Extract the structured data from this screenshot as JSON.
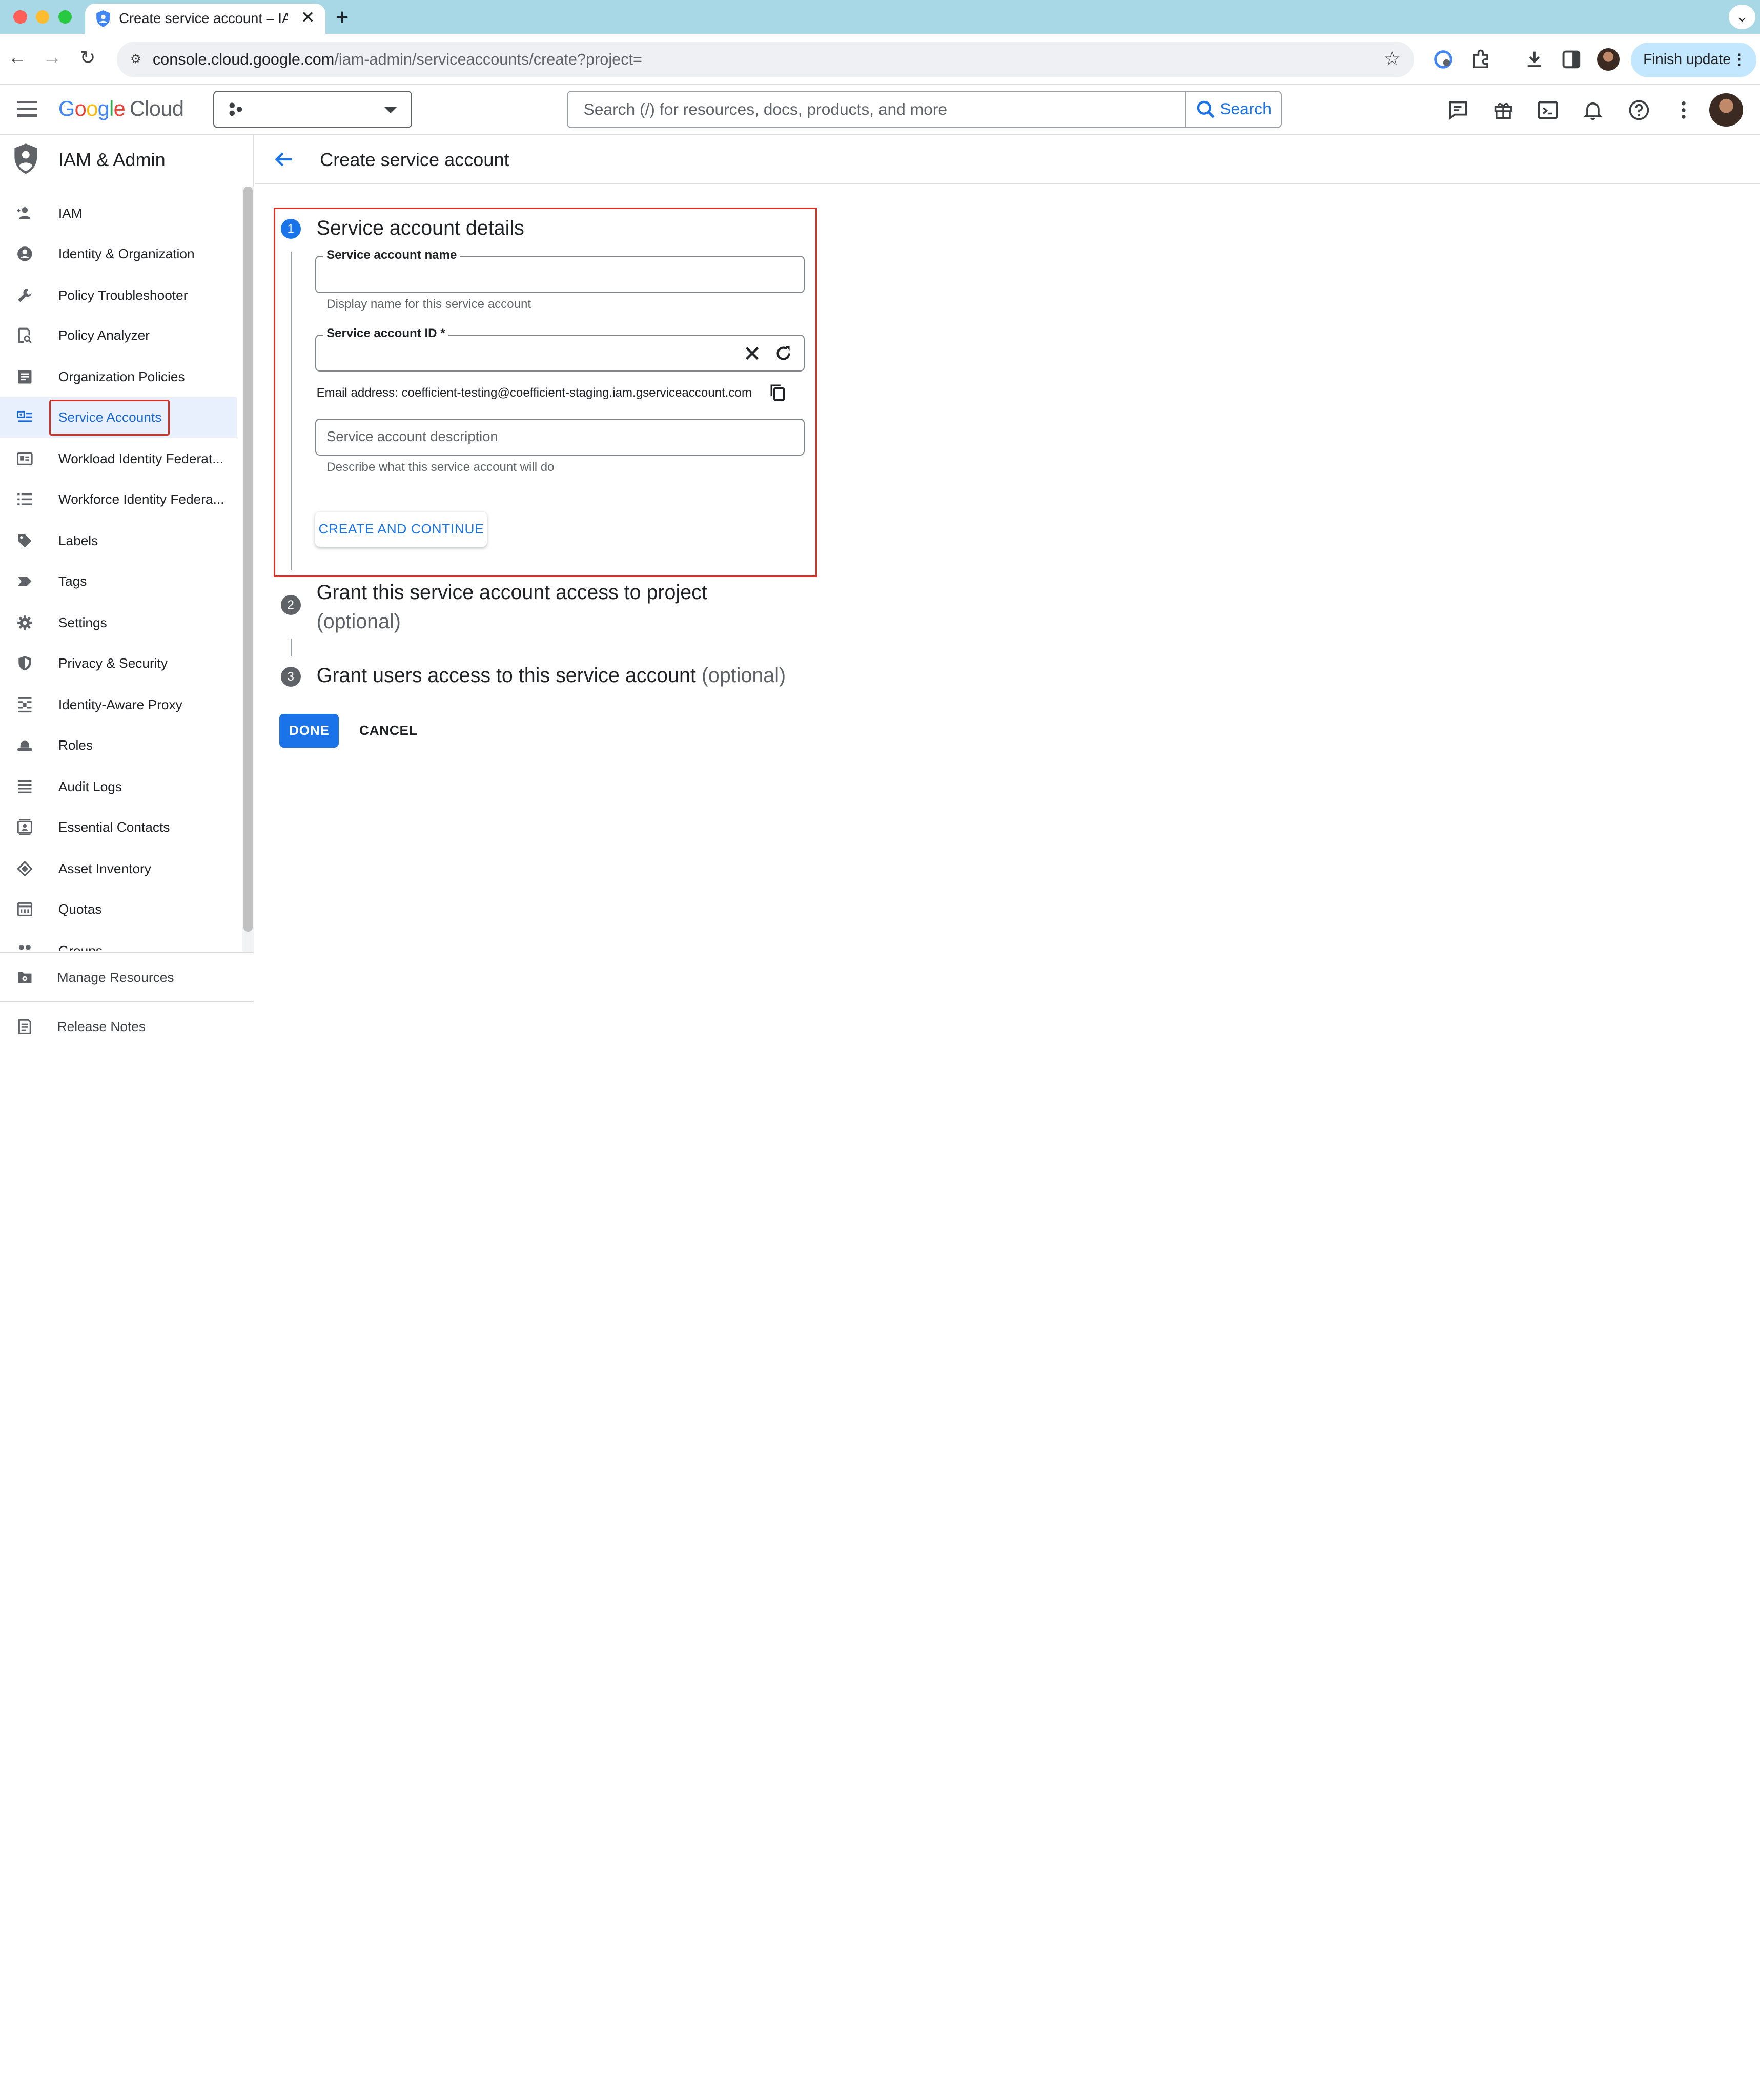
{
  "browser": {
    "tab_title": "Create service account – IAM",
    "url_host": "console.cloud.google.com",
    "url_path": "/iam-admin/serviceaccounts/create?project=",
    "finish_update_label": "Finish update"
  },
  "header": {
    "logo_google": "Google",
    "logo_cloud": "Cloud",
    "search_placeholder": "Search (/) for resources, docs, products, and more",
    "search_button": "Search"
  },
  "sidebar": {
    "title": "IAM & Admin",
    "items": [
      {
        "label": "IAM",
        "icon": "person-add-icon"
      },
      {
        "label": "Identity & Organization",
        "icon": "account-circle-icon"
      },
      {
        "label": "Policy Troubleshooter",
        "icon": "wrench-icon"
      },
      {
        "label": "Policy Analyzer",
        "icon": "document-search-icon"
      },
      {
        "label": "Organization Policies",
        "icon": "list-document-icon"
      },
      {
        "label": "Service Accounts",
        "icon": "service-account-icon"
      },
      {
        "label": "Workload Identity Federat...",
        "icon": "id-card-icon"
      },
      {
        "label": "Workforce Identity Federa...",
        "icon": "list-icon"
      },
      {
        "label": "Labels",
        "icon": "tag-icon"
      },
      {
        "label": "Tags",
        "icon": "label-arrow-icon"
      },
      {
        "label": "Settings",
        "icon": "gear-icon"
      },
      {
        "label": "Privacy & Security",
        "icon": "shield-icon"
      },
      {
        "label": "Identity-Aware Proxy",
        "icon": "proxy-icon"
      },
      {
        "label": "Roles",
        "icon": "hat-icon"
      },
      {
        "label": "Audit Logs",
        "icon": "lines-icon"
      },
      {
        "label": "Essential Contacts",
        "icon": "contacts-icon"
      },
      {
        "label": "Asset Inventory",
        "icon": "diamond-icon"
      },
      {
        "label": "Quotas",
        "icon": "calendar-icon"
      },
      {
        "label": "Groups",
        "icon": "groups-icon"
      }
    ],
    "active_item": "Service Accounts",
    "footer": [
      {
        "label": "Manage Resources",
        "icon": "settings-folder-icon"
      },
      {
        "label": "Release Notes",
        "icon": "notes-icon"
      }
    ]
  },
  "main": {
    "page_title": "Create service account",
    "steps": [
      {
        "number": "1",
        "title": "Service account details",
        "optional": ""
      },
      {
        "number": "2",
        "title": "Grant this service account access to project",
        "optional": "(optional)"
      },
      {
        "number": "3",
        "title": "Grant users access to this service account",
        "optional": "(optional)"
      }
    ],
    "form": {
      "name_label": "Service account name",
      "name_value": "",
      "name_hint": "Display name for this service account",
      "id_label": "Service account ID *",
      "id_value": "",
      "email_text": "Email address: coefficient-testing@coefficient-staging.iam.gserviceaccount.com",
      "description_placeholder": "Service account description",
      "description_hint": "Describe what this service account will do",
      "create_button": "CREATE AND CONTINUE"
    },
    "done_button": "DONE",
    "cancel_button": "CANCEL"
  },
  "colors": {
    "accent": "#1a73e8",
    "highlight_border": "#d93025",
    "step_inactive": "#5f6368"
  }
}
